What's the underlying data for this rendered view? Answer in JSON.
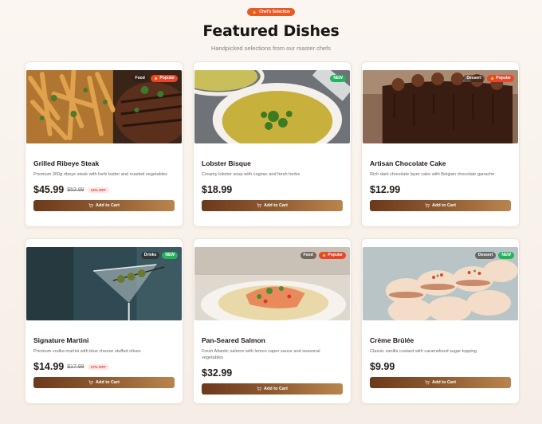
{
  "header": {
    "badge": "Chef's Selection",
    "title": "Featured Dishes",
    "subtitle": "Handpicked selections from our master chefs"
  },
  "dishes": [
    {
      "name": "Grilled Ribeye Steak",
      "description": "Premium 300g ribeye steak with herb butter and roasted vegetables",
      "price": "$45.99",
      "old_price": "$52.99",
      "discount": "13% OFF",
      "tags": [
        "Food",
        "Popular"
      ],
      "button": "Add to Cart"
    },
    {
      "name": "Lobster Bisque",
      "description": "Creamy lobster soup with cognac and fresh herbs",
      "price": "$18.99",
      "tags": [
        "NEW"
      ],
      "button": "Add to Cart"
    },
    {
      "name": "Artisan Chocolate Cake",
      "description": "Rich dark chocolate layer cake with Belgian chocolate ganache",
      "price": "$12.99",
      "tags": [
        "Dessert",
        "Popular"
      ],
      "button": "Add to Cart"
    },
    {
      "name": "Signature Martini",
      "description": "Premium vodka martini with blue cheese stuffed olives",
      "price": "$14.99",
      "old_price": "$17.99",
      "discount": "17% OFF",
      "tags": [
        "Drinks",
        "NEW"
      ],
      "button": "Add to Cart"
    },
    {
      "name": "Pan-Seared Salmon",
      "description": "Fresh Atlantic salmon with lemon caper sauce and seasonal vegetables",
      "price": "$32.99",
      "tags": [
        "Food",
        "Popular"
      ],
      "button": "Add to Cart"
    },
    {
      "name": "Crème Brûlée",
      "description": "Classic vanilla custard with caramelized sugar topping",
      "price": "$9.99",
      "tags": [
        "Dessert",
        "NEW"
      ],
      "button": "Add to Cart"
    }
  ],
  "colors": {
    "accent": "#ea5a24",
    "popular": "#e8452a",
    "new": "#22b45b",
    "button_start": "#6b3a1c",
    "button_end": "#b9854d"
  },
  "icons": {
    "badge": "flame-icon",
    "popular": "flame-icon",
    "button": "cart-icon"
  }
}
